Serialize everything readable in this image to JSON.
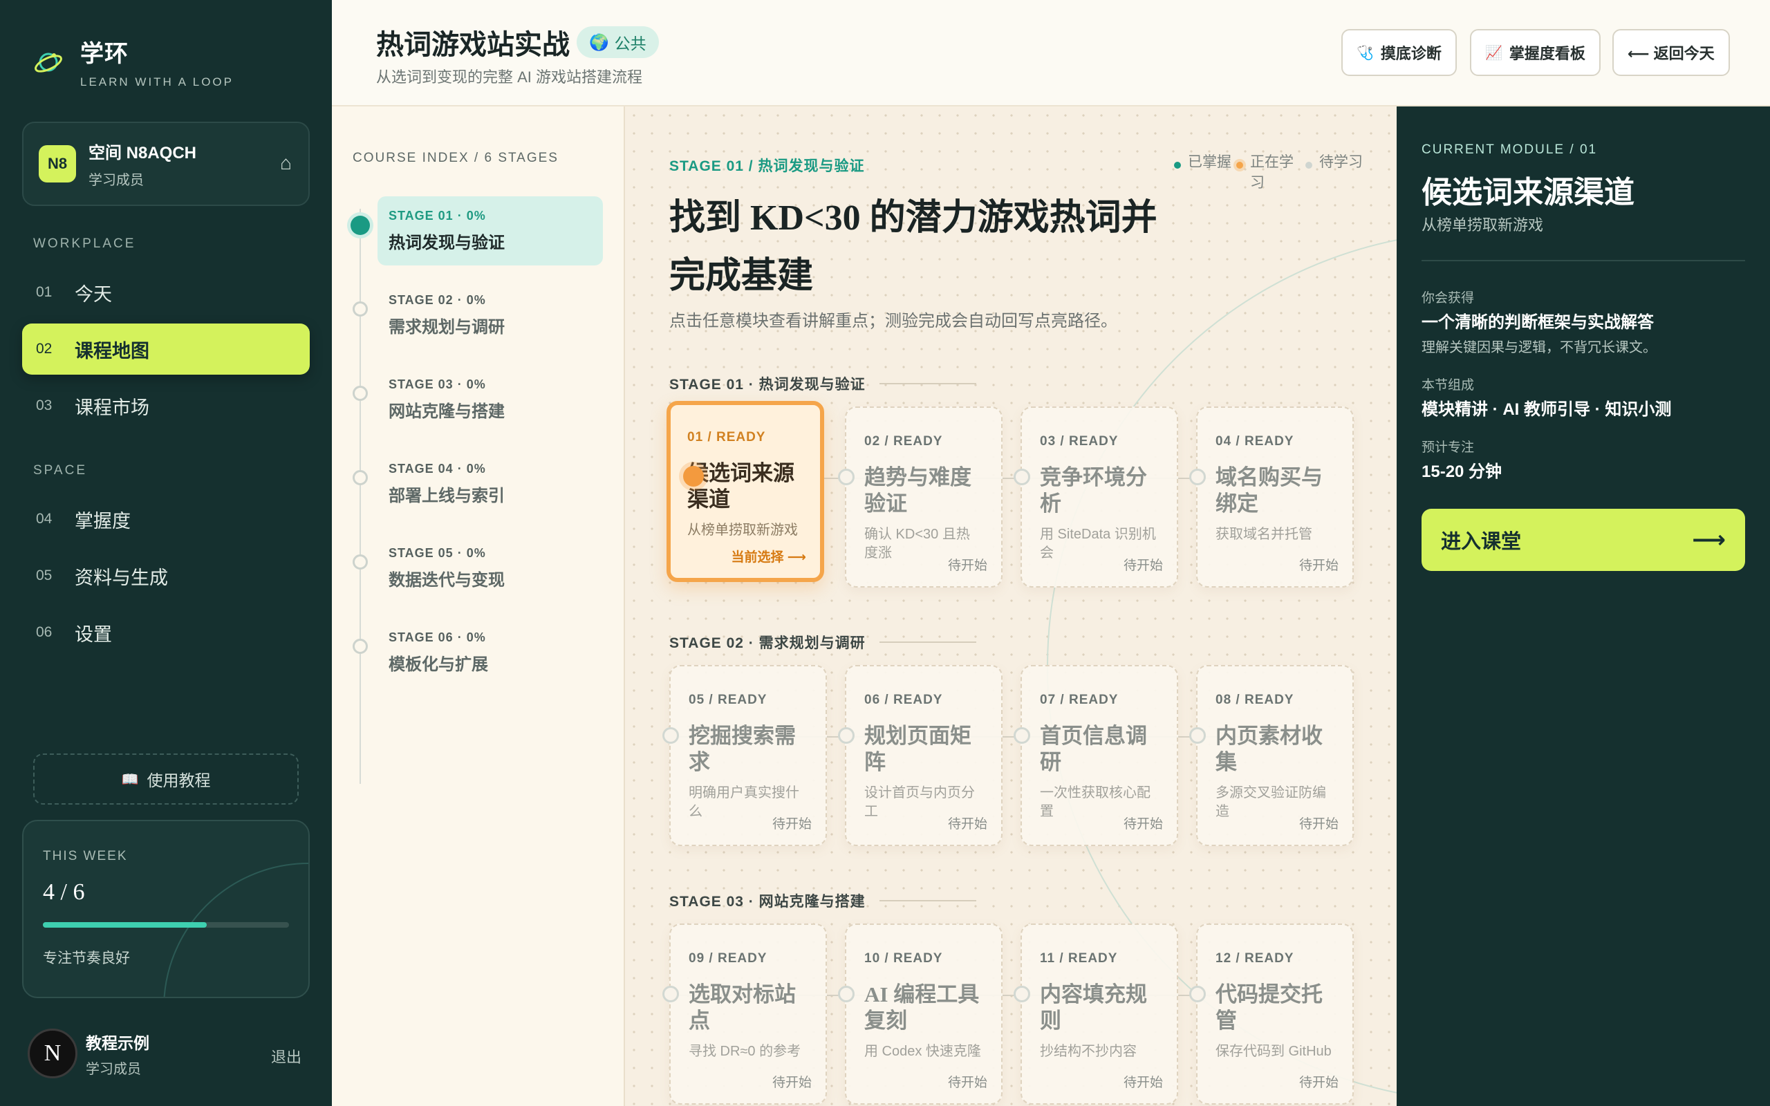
{
  "brand": {
    "name": "学环",
    "tagline": "LEARN WITH A LOOP"
  },
  "space": {
    "badge": "N8",
    "title": "空间 N8AQCH",
    "role": "学习成员",
    "home_icon": "home-icon"
  },
  "sidebar": {
    "workplace_label": "WORKPLACE",
    "workplace_items": [
      {
        "num": "01",
        "label": "今天"
      },
      {
        "num": "02",
        "label": "课程地图"
      },
      {
        "num": "03",
        "label": "课程市场"
      }
    ],
    "space_label": "SPACE",
    "space_items": [
      {
        "num": "04",
        "label": "掌握度"
      },
      {
        "num": "05",
        "label": "资料与生成"
      },
      {
        "num": "06",
        "label": "设置"
      }
    ],
    "tutorial": "使用教程"
  },
  "week": {
    "label": "THIS WEEK",
    "value": "4 / 6",
    "progress": 0.667,
    "note": "专注节奏良好"
  },
  "user": {
    "avatar": "N",
    "name": "教程示例",
    "role": "学习成员",
    "logout": "退出"
  },
  "header": {
    "title": "热词游戏站实战",
    "badge": "公共",
    "subtitle": "从选词到变现的完整 AI 游戏站搭建流程",
    "buttons": [
      "摸底诊断",
      "掌握度看板",
      "⟵ 返回今天"
    ]
  },
  "index": {
    "title": "COURSE INDEX / 6 STAGES",
    "stages": [
      {
        "code": "STAGE 01 · 0%",
        "name": "热词发现与验证"
      },
      {
        "code": "STAGE 02 · 0%",
        "name": "需求规划与调研"
      },
      {
        "code": "STAGE 03 · 0%",
        "name": "网站克隆与搭建"
      },
      {
        "code": "STAGE 04 · 0%",
        "name": "部署上线与索引"
      },
      {
        "code": "STAGE 05 · 0%",
        "name": "数据迭代与变现"
      },
      {
        "code": "STAGE 06 · 0%",
        "name": "模板化与扩展"
      }
    ]
  },
  "map": {
    "stage_kicker": "STAGE 01 / 热词发现与验证",
    "title": "找到 KD<30 的潜力游戏热词并完成基建",
    "desc": "点击任意模块查看讲解重点；测验完成会自动回写点亮路径。",
    "legend": [
      {
        "label": "已掌握",
        "color": "#1a9a83"
      },
      {
        "label": "正在学习",
        "color": "#f5a54a"
      },
      {
        "label": "待学习",
        "color": "#cfd5d0"
      }
    ],
    "groups": [
      {
        "header": "STAGE 01 · 热词发现与验证",
        "cards": [
          {
            "code": "01 / READY",
            "name": "候选词来源渠道",
            "desc": "从榜单捞取新游戏",
            "status": "当前选择 ⟶"
          },
          {
            "code": "02 / READY",
            "name": "趋势与难度验证",
            "desc": "确认 KD<30 且热度涨",
            "status": "待开始"
          },
          {
            "code": "03 / READY",
            "name": "竞争环境分析",
            "desc": "用 SiteData 识别机会",
            "status": "待开始"
          },
          {
            "code": "04 / READY",
            "name": "域名购买与绑定",
            "desc": "获取域名并托管",
            "status": "待开始"
          }
        ]
      },
      {
        "header": "STAGE 02 · 需求规划与调研",
        "cards": [
          {
            "code": "05 / READY",
            "name": "挖掘搜索需求",
            "desc": "明确用户真实搜什么",
            "status": "待开始"
          },
          {
            "code": "06 / READY",
            "name": "规划页面矩阵",
            "desc": "设计首页与内页分工",
            "status": "待开始"
          },
          {
            "code": "07 / READY",
            "name": "首页信息调研",
            "desc": "一次性获取核心配置",
            "status": "待开始"
          },
          {
            "code": "08 / READY",
            "name": "内页素材收集",
            "desc": "多源交叉验证防编造",
            "status": "待开始"
          }
        ]
      },
      {
        "header": "STAGE 03 · 网站克隆与搭建",
        "cards": [
          {
            "code": "09 / READY",
            "name": "选取对标站点",
            "desc": "寻找 DR≈0 的参考",
            "status": "待开始"
          },
          {
            "code": "10 / READY",
            "name": "AI 编程工具复刻",
            "desc": "用 Codex 快速克隆",
            "status": "待开始"
          },
          {
            "code": "11 / READY",
            "name": "内容填充规则",
            "desc": "抄结构不抄内容",
            "status": "待开始"
          },
          {
            "code": "12 / READY",
            "name": "代码提交托管",
            "desc": "保存代码到 GitHub",
            "status": "待开始"
          }
        ]
      }
    ]
  },
  "panel": {
    "kicker": "CURRENT MODULE / 01",
    "title": "候选词来源渠道",
    "subtitle": "从榜单捞取新游戏",
    "gain_label": "你会获得",
    "gain_value": "一个清晰的判断框架与实战解答",
    "gain_note": "理解关键因果与逻辑，不背冗长课文。",
    "compose_label": "本节组成",
    "compose_value": "模块精讲 · AI 教师引导 · 知识小测",
    "focus_label": "预计专注",
    "focus_value": "15-20 分钟",
    "enter": "进入课堂",
    "enter_arrow": "⟶"
  },
  "colors": {
    "accent": "#d4f25c",
    "sidebar": "#15302f",
    "teal": "#1a9a83",
    "orange": "#f5a54a"
  }
}
